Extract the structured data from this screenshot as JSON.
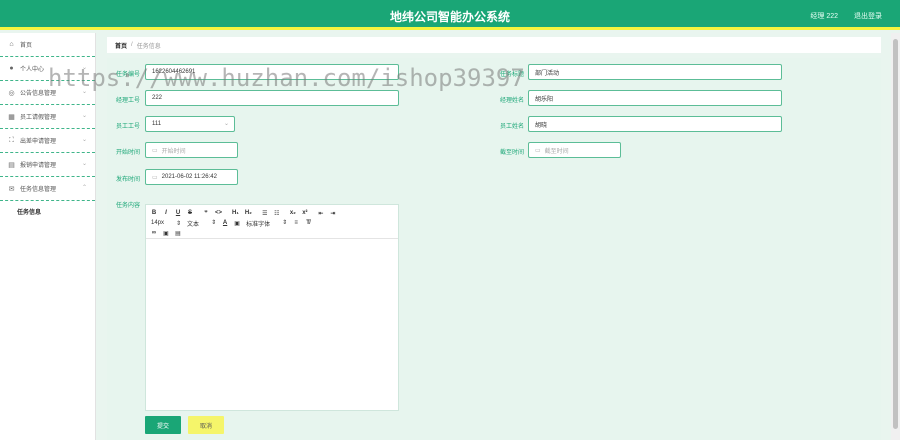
{
  "header": {
    "title": "地纬公司智能办公系统",
    "user": "经理 222",
    "logout": "退出登录"
  },
  "sidebar": {
    "items": [
      {
        "label": "首页",
        "icon": "home-icon",
        "glyph": "⌂"
      },
      {
        "label": "个人中心",
        "icon": "user-icon",
        "glyph": "●"
      },
      {
        "label": "公告信息管理",
        "icon": "notice-icon",
        "glyph": "◎"
      },
      {
        "label": "员工请假管理",
        "icon": "leave-icon",
        "glyph": "▦"
      },
      {
        "label": "出差申请管理",
        "icon": "trip-icon",
        "glyph": "⛶"
      },
      {
        "label": "报销申请管理",
        "icon": "reimburse-icon",
        "glyph": "▤"
      },
      {
        "label": "任务信息管理",
        "icon": "task-icon",
        "glyph": "✉"
      }
    ],
    "sub_item": "任务信息"
  },
  "breadcrumb": {
    "home": "首页",
    "sep": "/",
    "current": "任务信息"
  },
  "form": {
    "task_no_label": "任务编号",
    "task_no_value": "1622604462691",
    "task_title_label": "任务标题",
    "task_title_value": "部门活动",
    "mgr_no_label": "经理工号",
    "mgr_no_value": "222",
    "mgr_name_label": "经理姓名",
    "mgr_name_value": "胡乐阳",
    "emp_no_label": "员工工号",
    "emp_no_value": "111",
    "emp_name_label": "员工姓名",
    "emp_name_value": "胡晓",
    "start_label": "开始时间",
    "start_placeholder": "开始时间",
    "deadline_label": "截至时间",
    "deadline_placeholder": "截至时间",
    "publish_label": "发布时间",
    "publish_value": "2021-06-02 11:26:42",
    "content_label": "任务内容"
  },
  "editor": {
    "row1": [
      "B",
      "I",
      "U",
      "S",
      "❞",
      "<>",
      "H₁",
      "H₂",
      "☰",
      "☷",
      "x₂",
      "x²",
      "⇤",
      "⇥"
    ],
    "size": "14px",
    "text": "文本",
    "font": "标准字体",
    "row3": [
      "🔗",
      "▣",
      "▤"
    ]
  },
  "buttons": {
    "submit": "提交",
    "cancel": "取消"
  },
  "watermark": "https://www.huzhan.com/ishop39397"
}
